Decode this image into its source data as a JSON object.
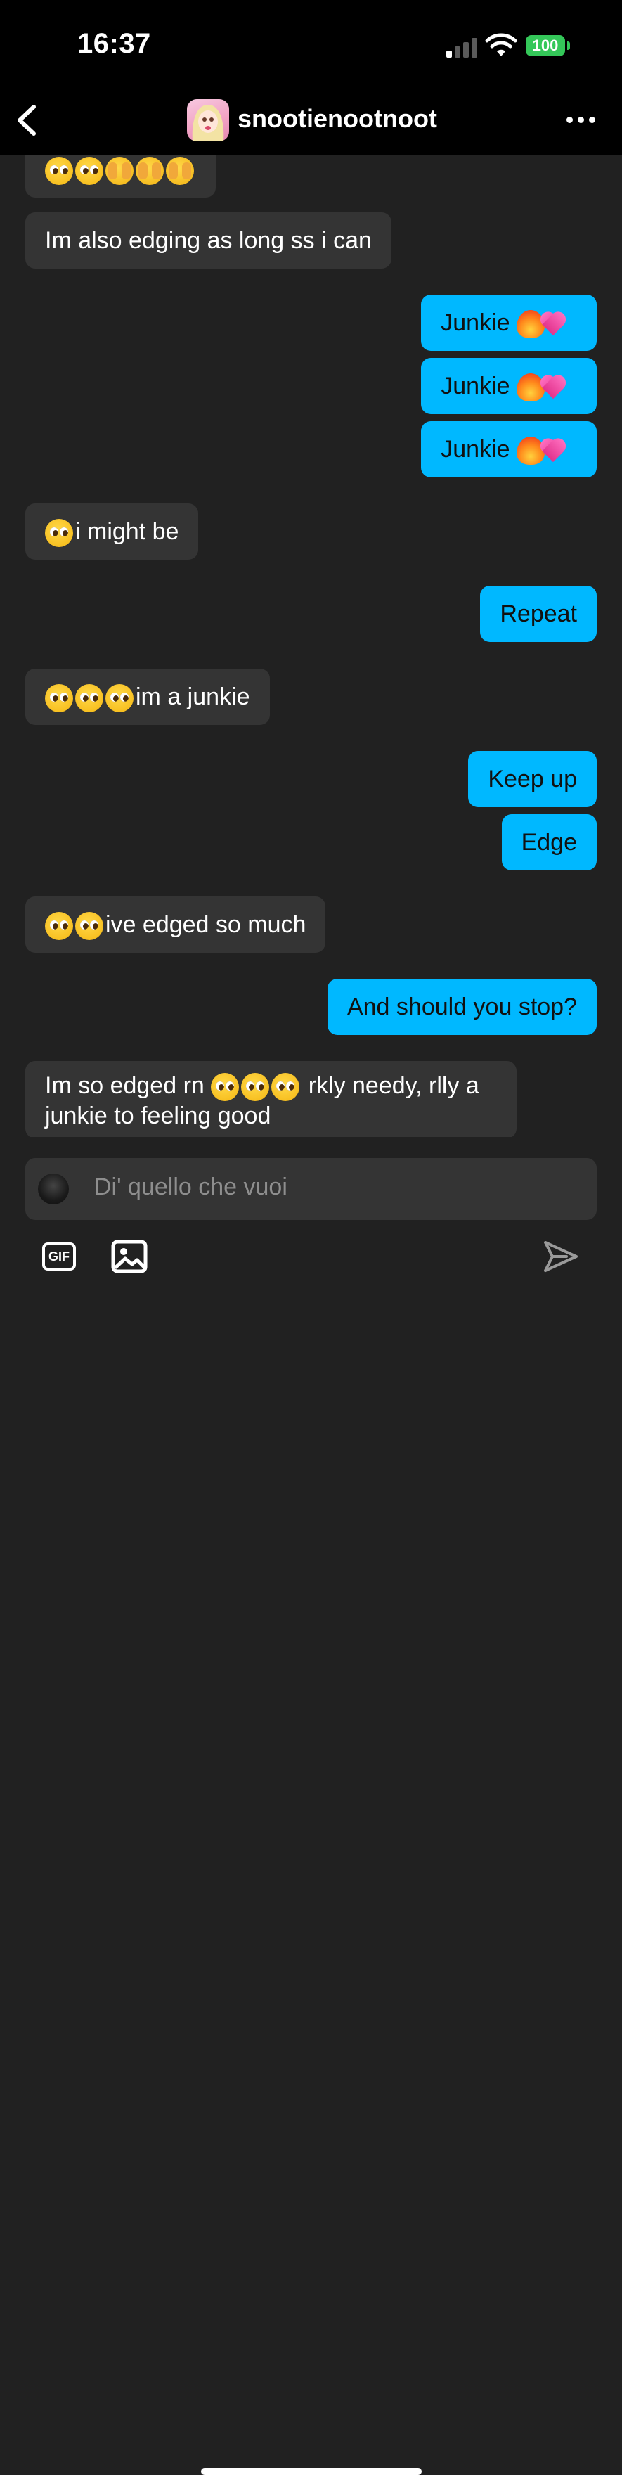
{
  "status_bar": {
    "time": "16:37",
    "battery": "100"
  },
  "header": {
    "username": "snootienootnoot"
  },
  "messages": [
    {
      "side": "in",
      "text": "",
      "emojis": [
        "pleading",
        "pleading",
        "peek",
        "peek",
        "peek"
      ]
    },
    {
      "side": "in",
      "text": "Im also edging as long ss i can",
      "emojis": []
    },
    {
      "side": "out",
      "text": "Junkie",
      "emojis_after": [
        "fire",
        "heart"
      ]
    },
    {
      "side": "out",
      "text": "Junkie",
      "emojis_after": [
        "fire",
        "heart"
      ]
    },
    {
      "side": "out",
      "text": "Junkie",
      "emojis_after": [
        "fire",
        "heart"
      ]
    },
    {
      "side": "in",
      "text": "i might be",
      "emojis": [
        "pleading"
      ]
    },
    {
      "side": "out",
      "text": "Repeat"
    },
    {
      "side": "in",
      "text": "im a junkie",
      "emojis": [
        "pleading",
        "pleading",
        "pleading"
      ]
    },
    {
      "side": "out",
      "text": "Keep up"
    },
    {
      "side": "out",
      "text": "Edge"
    },
    {
      "side": "in",
      "text": "ive edged so much",
      "emojis": [
        "pleading",
        "pleading"
      ]
    },
    {
      "side": "out",
      "text": "And should you stop?"
    },
    {
      "side": "in",
      "text_before": "Im so edged rn",
      "emojis": [
        "pleading",
        "pleading",
        "pleading"
      ],
      "text_after": "rkly needy, rlly a junkie to feeling good"
    }
  ],
  "composer": {
    "placeholder": "Di' quello che vuoi",
    "gif_label": "GIF"
  },
  "colors": {
    "outgoing_bubble": "#00b8ff",
    "incoming_bubble": "#343434",
    "background": "#212121"
  }
}
